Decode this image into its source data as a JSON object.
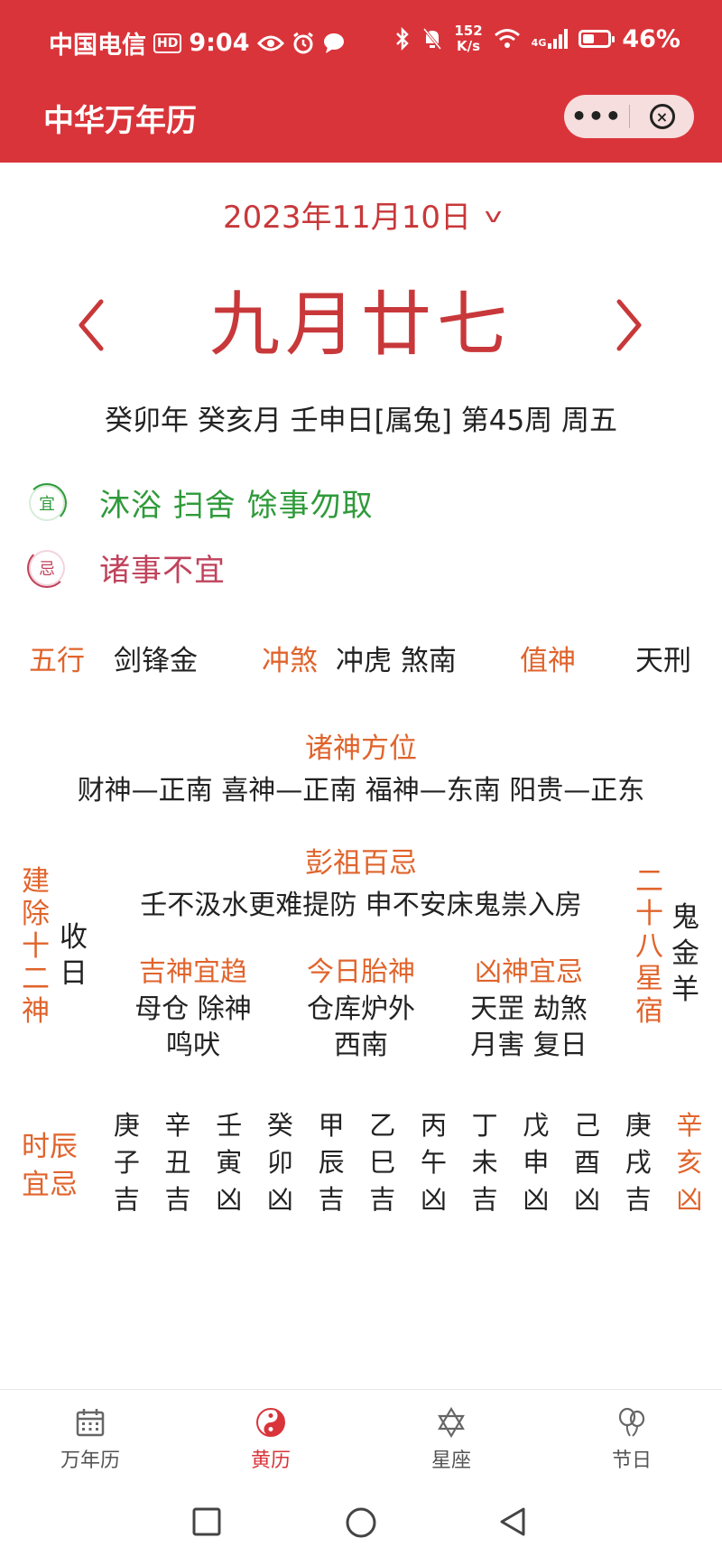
{
  "status_bar": {
    "carrier": "中国电信",
    "hd": "HD",
    "time": "9:04",
    "speed_value": "152",
    "speed_unit": "K/s",
    "network": "4G",
    "battery": "46%",
    "battery_level": 0.46
  },
  "header": {
    "title": "中华万年历",
    "more_label": "•••",
    "close_label": "×"
  },
  "date": {
    "gregorian": "2023年11月10日",
    "lunar": "九月廿七",
    "ganzhi": "癸卯年 癸亥月 壬申日[属兔] 第45周 周五"
  },
  "yi": {
    "badge": "宜",
    "text": "沐浴 扫舍 馀事勿取"
  },
  "ji": {
    "badge": "忌",
    "text": "诸事不宜"
  },
  "info_row": {
    "wuxing_label": "五行",
    "wuxing_value": "剑锋金",
    "chongsha_label": "冲煞",
    "chongsha_value": "冲虎 煞南",
    "zhishen_label": "值神",
    "zhishen_value": "天刑"
  },
  "zhushen": {
    "title": "诸神方位",
    "text": "财神—正南 喜神—正南 福神—东南 阳贵—正东"
  },
  "pengzu": {
    "title": "彭祖百忌",
    "text": "壬不汲水更难提防 申不安床鬼祟入房"
  },
  "jianchu": {
    "label_chars": [
      "建",
      "除",
      "十",
      "二",
      "神"
    ],
    "value_chars": [
      "收",
      "日"
    ]
  },
  "xingxiu": {
    "label_chars": [
      "二",
      "十",
      "八",
      "星",
      "宿"
    ],
    "value_chars": [
      "鬼",
      "金",
      "羊"
    ]
  },
  "columns": [
    {
      "title": "吉神宜趋",
      "lines": [
        "母仓 除神",
        "鸣吠"
      ]
    },
    {
      "title": "今日胎神",
      "lines": [
        "仓库炉外",
        "西南"
      ]
    },
    {
      "title": "凶神宜忌",
      "lines": [
        "天罡 劫煞",
        "月害 复日"
      ]
    }
  ],
  "hours": {
    "label_lines": [
      "时辰",
      "宜忌"
    ],
    "items": [
      {
        "gan": "庚",
        "zhi": "子",
        "luck": "吉"
      },
      {
        "gan": "辛",
        "zhi": "丑",
        "luck": "吉"
      },
      {
        "gan": "壬",
        "zhi": "寅",
        "luck": "凶"
      },
      {
        "gan": "癸",
        "zhi": "卯",
        "luck": "凶"
      },
      {
        "gan": "甲",
        "zhi": "辰",
        "luck": "吉"
      },
      {
        "gan": "乙",
        "zhi": "巳",
        "luck": "吉"
      },
      {
        "gan": "丙",
        "zhi": "午",
        "luck": "凶"
      },
      {
        "gan": "丁",
        "zhi": "未",
        "luck": "吉"
      },
      {
        "gan": "戊",
        "zhi": "申",
        "luck": "凶"
      },
      {
        "gan": "己",
        "zhi": "酉",
        "luck": "凶"
      },
      {
        "gan": "庚",
        "zhi": "戌",
        "luck": "吉"
      },
      {
        "gan": "辛",
        "zhi": "亥",
        "luck": "凶",
        "highlight": true
      }
    ]
  },
  "tabs": [
    {
      "label": "万年历",
      "icon": "calendar-icon",
      "active": false
    },
    {
      "label": "黄历",
      "icon": "yin-yang-icon",
      "active": true
    },
    {
      "label": "星座",
      "icon": "star-of-david-icon",
      "active": false
    },
    {
      "label": "节日",
      "icon": "balloons-icon",
      "active": false
    }
  ],
  "colors": {
    "brand_red": "#d9343a",
    "title_red": "#c8383a",
    "accent_orange": "#e0642c",
    "yi_green": "#2f9a3a",
    "ji_rose": "#c0435c"
  }
}
